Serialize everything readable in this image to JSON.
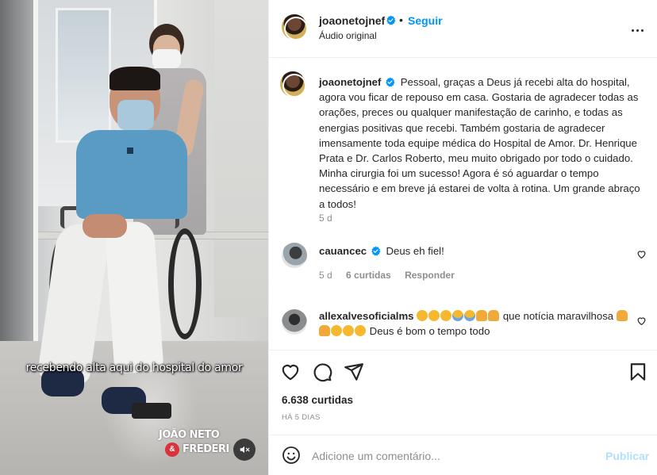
{
  "post": {
    "username": "joaonetojnef",
    "follow_label": "Seguir",
    "dot": "•",
    "audio_label": "Áudio original"
  },
  "media": {
    "caption_overlay": "recebendo alta aqui do hospital do amor",
    "watermark_line1": "JOÃO NETO",
    "watermark_badge": "&",
    "watermark_line2": "FREDERI"
  },
  "caption": {
    "username": "joaonetojnef",
    "text": "Pessoal, graças a Deus já recebi alta do hospital, agora vou ficar de repouso em casa. Gostaria de agradecer todas as orações, preces ou qualquer manifestação de carinho, e todas as energias positivas que recebi. Também gostaria de agradecer imensamente toda equipe médica do Hospital de Amor. Dr. Henrique Prata e Dr. Carlos Roberto, meu muito obrigado por todo o cuidado. Minha cirurgia foi um sucesso! Agora é só aguardar o tempo necessário e em breve já estarei de volta à rotina. Um grande abraço a todos!",
    "time": "5 d"
  },
  "comments": [
    {
      "username": "cauancec",
      "text": "Deus eh fiel!",
      "time": "5 d",
      "likes": "6 curtidas",
      "reply": "Responder"
    },
    {
      "username": "allexalvesoficialms",
      "text_after_emojis": "que notícia maravilhosa",
      "text_end": "Deus é bom o tempo todo"
    }
  ],
  "stats": {
    "likes": "6.638 curtidas",
    "date": "HÁ 5 DIAS"
  },
  "composer": {
    "placeholder": "Adicione um comentário...",
    "publish_label": "Publicar"
  },
  "colors": {
    "accent": "#0095f6",
    "publish_disabled": "#b2dffc",
    "secondary_text": "#8e8e8e"
  },
  "icons": [
    "verified-badge-icon",
    "more-options-icon",
    "heart-icon",
    "comment-icon",
    "share-icon",
    "bookmark-icon",
    "emoji-icon",
    "muted-speaker-icon"
  ]
}
